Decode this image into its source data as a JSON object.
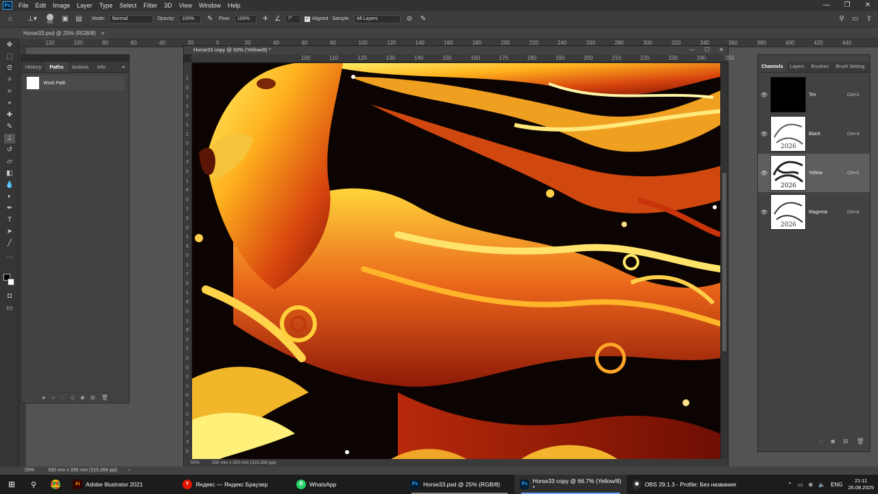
{
  "app": {
    "logo": "Ps"
  },
  "menu": [
    "File",
    "Edit",
    "Image",
    "Layer",
    "Type",
    "Select",
    "Filter",
    "3D",
    "View",
    "Window",
    "Help"
  ],
  "window_controls": [
    "—",
    "❐",
    "✕"
  ],
  "options": {
    "brush_size": "432",
    "mode_label": "Mode:",
    "mode_value": "Normal",
    "opacity_label": "Opacity:",
    "opacity_value": "100%",
    "flow_label": "Flow:",
    "flow_value": "100%",
    "angle_value": "7°",
    "aligned_label": "Aligned",
    "sample_label": "Sample:",
    "sample_value": "All Layers"
  },
  "doc_tab": {
    "title": "Horse33.psd @ 25% (RGB/8)",
    "close": "×"
  },
  "main_ruler": [
    "120",
    "100",
    "80",
    "60",
    "40",
    "20",
    "0",
    "20",
    "40",
    "60",
    "80",
    "100",
    "120",
    "140",
    "160",
    "180",
    "200",
    "220",
    "240",
    "260",
    "280",
    "300",
    "320",
    "340",
    "360",
    "380",
    "400",
    "420",
    "440"
  ],
  "paths_panel": {
    "tabs": [
      "History",
      "Paths",
      "Actions",
      "Info"
    ],
    "active_tab": "Paths",
    "path_name": "Work Path",
    "footer_icons": [
      "●",
      "○",
      "◌",
      "◇",
      "◙",
      "⊞",
      "🗑"
    ]
  },
  "document": {
    "title": "Horse33 copy @ 50% (Yellow/8) *",
    "controls": [
      "—",
      "☐",
      "✕"
    ],
    "hruler": [
      "100",
      "110",
      "120",
      "130",
      "140",
      "150",
      "160",
      "170",
      "180",
      "190",
      "200",
      "210",
      "220",
      "230",
      "240",
      "250"
    ],
    "vruler": [
      "1",
      "0",
      "1",
      "1",
      "0",
      "1",
      "2",
      "0",
      "1",
      "3",
      "0",
      "1",
      "4",
      "0",
      "1",
      "5",
      "0",
      "1",
      "6",
      "0",
      "1",
      "7",
      "0",
      "1",
      "8",
      "0",
      "1",
      "9",
      "0",
      "2",
      "0",
      "0",
      "2",
      "1",
      "0",
      "2",
      "2",
      "0",
      "2",
      "3",
      "0"
    ],
    "zoom": "50%",
    "size": "330 mm x 330 mm (315.268 ppi)"
  },
  "channels_panel": {
    "tabs": [
      "Channels",
      "Layers",
      "Brushes",
      "Brush Setting"
    ],
    "active_tab": "Channels",
    "channels": [
      {
        "name": "Tex",
        "shortcut": "Ctrl+3"
      },
      {
        "name": "Black",
        "shortcut": "Ctrl+4"
      },
      {
        "name": "Yellow",
        "shortcut": "Ctrl+5"
      },
      {
        "name": "Magenta",
        "shortcut": "Ctrl+6"
      }
    ],
    "thumb_text": "2026",
    "footer_icons": [
      "◌",
      "◙",
      "⊞",
      "🗑"
    ]
  },
  "status": {
    "zoom": "25%",
    "size": "330 mm x 330 mm (315.268 ppi)",
    "arrow": "›"
  },
  "taskbar": {
    "items": [
      {
        "label": "Adobe Illustrator 2021",
        "icon": "Ai",
        "color": "#ff9a00",
        "bg": "#330000"
      },
      {
        "label": "Яндекс — Яндекс Браузер",
        "icon": "Y",
        "color": "#ffffff",
        "bg": "#e61400"
      },
      {
        "label": "WhatsApp",
        "icon": "✆",
        "color": "#ffffff",
        "bg": "#25d366"
      },
      {
        "label": "Horse33.psd @ 25% (RGB/8)",
        "icon": "Ps",
        "color": "#31a8ff",
        "bg": "#001e36"
      },
      {
        "label": "Horse33 copy @ 66.7% (Yellow/8) *",
        "icon": "Ps",
        "color": "#31a8ff",
        "bg": "#001e36"
      },
      {
        "label": "OBS 29.1.3 - Profile: Без названия - ...",
        "icon": "◉",
        "color": "#ffffff",
        "bg": "#302e31"
      }
    ],
    "lang": "ENG",
    "time": "21:11",
    "date": "26.08.2025"
  },
  "colors": {
    "accent": "#31a8ff",
    "panel": "#424242",
    "dark": "#323232"
  }
}
